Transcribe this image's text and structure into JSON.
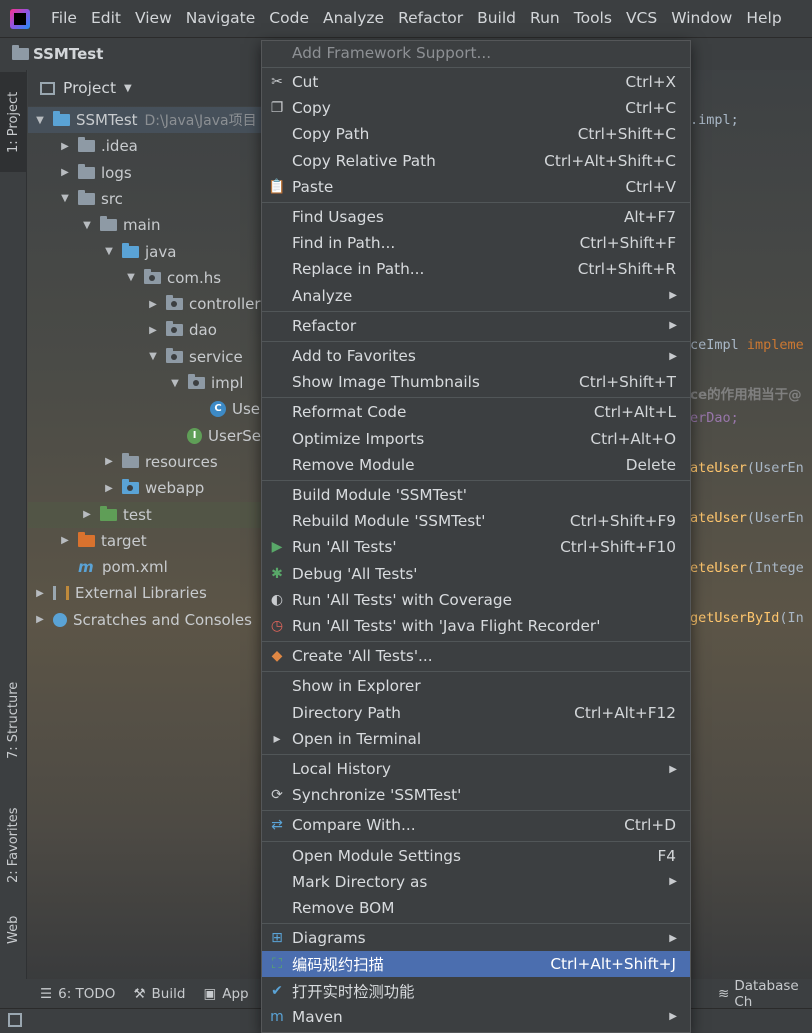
{
  "menubar": {
    "items": [
      "File",
      "Edit",
      "View",
      "Navigate",
      "Code",
      "Analyze",
      "Refactor",
      "Build",
      "Run",
      "Tools",
      "VCS",
      "Window",
      "Help"
    ]
  },
  "breadcrumb": {
    "project_name": "SSMTest"
  },
  "left_strip": {
    "project_tab": "1: Project",
    "structure_tab": "7: Structure",
    "favorites_tab": "2: Favorites",
    "web_tab": "Web"
  },
  "project_panel": {
    "header": "Project",
    "tree": [
      {
        "label": "SSMTest",
        "path": "D:\\Java\\Java项目",
        "arrow": "down",
        "icon": "module-folder",
        "selected": true
      },
      {
        "label": ".idea",
        "arrow": "right",
        "icon": "folder"
      },
      {
        "label": "logs",
        "arrow": "right",
        "icon": "folder"
      },
      {
        "label": "src",
        "arrow": "down",
        "icon": "folder"
      },
      {
        "label": "main",
        "arrow": "down",
        "icon": "folder"
      },
      {
        "label": "java",
        "arrow": "down",
        "icon": "source-folder"
      },
      {
        "label": "com.hs",
        "arrow": "down",
        "icon": "package"
      },
      {
        "label": "controller",
        "arrow": "right",
        "icon": "package"
      },
      {
        "label": "dao",
        "arrow": "right",
        "icon": "package"
      },
      {
        "label": "service",
        "arrow": "down",
        "icon": "package"
      },
      {
        "label": "impl",
        "arrow": "down",
        "icon": "package"
      },
      {
        "label": "Use",
        "arrow": "",
        "icon": "class"
      },
      {
        "label": "UserSe",
        "arrow": "",
        "icon": "interface"
      },
      {
        "label": "resources",
        "arrow": "right",
        "icon": "resources-folder"
      },
      {
        "label": "webapp",
        "arrow": "right",
        "icon": "web-folder"
      },
      {
        "label": "test",
        "arrow": "right",
        "icon": "test-folder",
        "highlight": true
      },
      {
        "label": "target",
        "arrow": "right",
        "icon": "excluded-folder"
      },
      {
        "label": "pom.xml",
        "arrow": "",
        "icon": "maven"
      },
      {
        "label": "External Libraries",
        "arrow": "right",
        "icon": "libraries"
      },
      {
        "label": "Scratches and Consoles",
        "arrow": "right",
        "icon": "scratches"
      }
    ]
  },
  "editor_fragments": [
    {
      "text": ".impl;",
      "kind": "plain"
    },
    {
      "text": "ceImpl ",
      "kind": "plain",
      "kw": "impleme"
    },
    {
      "text": "ce的作用相当于@",
      "kind": "comment"
    },
    {
      "text": "erDao;",
      "kind": "field"
    },
    {
      "text": "ateUser",
      "kind": "fn",
      "rest": "(UserEn"
    },
    {
      "text": "ateUser",
      "kind": "fn",
      "rest": "(UserEn"
    },
    {
      "text": "eteUser",
      "kind": "fn",
      "rest": "(Intege"
    },
    {
      "text": "getUserById",
      "kind": "fn",
      "rest": "(In"
    }
  ],
  "context_menu": {
    "partial_top": "Add Framework Support...",
    "groups": [
      [
        {
          "label": "Cut",
          "shortcut": "Ctrl+X",
          "icon": "cut"
        },
        {
          "label": "Copy",
          "shortcut": "Ctrl+C",
          "icon": "copy"
        },
        {
          "label": "Copy Path",
          "shortcut": "Ctrl+Shift+C"
        },
        {
          "label": "Copy Relative Path",
          "shortcut": "Ctrl+Alt+Shift+C"
        },
        {
          "label": "Paste",
          "shortcut": "Ctrl+V",
          "icon": "paste"
        }
      ],
      [
        {
          "label": "Find Usages",
          "shortcut": "Alt+F7"
        },
        {
          "label": "Find in Path...",
          "shortcut": "Ctrl+Shift+F"
        },
        {
          "label": "Replace in Path...",
          "shortcut": "Ctrl+Shift+R"
        },
        {
          "label": "Analyze",
          "submenu": true
        }
      ],
      [
        {
          "label": "Refactor",
          "submenu": true
        }
      ],
      [
        {
          "label": "Add to Favorites",
          "submenu": true
        },
        {
          "label": "Show Image Thumbnails",
          "shortcut": "Ctrl+Shift+T"
        }
      ],
      [
        {
          "label": "Reformat Code",
          "shortcut": "Ctrl+Alt+L"
        },
        {
          "label": "Optimize Imports",
          "shortcut": "Ctrl+Alt+O"
        },
        {
          "label": "Remove Module",
          "shortcut": "Delete"
        }
      ],
      [
        {
          "label": "Build Module 'SSMTest'"
        },
        {
          "label": "Rebuild Module 'SSMTest'",
          "shortcut": "Ctrl+Shift+F9"
        },
        {
          "label": "Run 'All Tests'",
          "shortcut": "Ctrl+Shift+F10",
          "icon": "run"
        },
        {
          "label": "Debug 'All Tests'",
          "icon": "debug"
        },
        {
          "label": "Run 'All Tests' with Coverage",
          "icon": "coverage"
        },
        {
          "label": "Run 'All Tests' with 'Java Flight Recorder'",
          "icon": "profiler"
        }
      ],
      [
        {
          "label": "Create 'All Tests'...",
          "icon": "create-config"
        }
      ],
      [
        {
          "label": "Show in Explorer"
        },
        {
          "label": "Directory Path",
          "shortcut": "Ctrl+Alt+F12"
        },
        {
          "label": "Open in Terminal",
          "icon": "terminal"
        }
      ],
      [
        {
          "label": "Local History",
          "submenu": true
        },
        {
          "label": "Synchronize 'SSMTest'",
          "icon": "sync"
        }
      ],
      [
        {
          "label": "Compare With...",
          "shortcut": "Ctrl+D",
          "icon": "compare"
        }
      ],
      [
        {
          "label": "Open Module Settings",
          "shortcut": "F4"
        },
        {
          "label": "Mark Directory as",
          "submenu": true
        },
        {
          "label": "Remove BOM"
        }
      ],
      [
        {
          "label": "Diagrams",
          "submenu": true,
          "icon": "diagram"
        },
        {
          "label": "编码规约扫描",
          "shortcut": "Ctrl+Alt+Shift+J",
          "icon": "alibaba-scan",
          "active": true
        },
        {
          "label": "打开实时检测功能",
          "icon": "realtime-check"
        },
        {
          "label": "Maven",
          "submenu": true,
          "icon": "maven"
        }
      ]
    ]
  },
  "bottom_bar": {
    "todo": "6: TODO",
    "build": "Build",
    "app": "App",
    "database": "Database Ch"
  },
  "colors": {
    "menu_bg": "#3c3f41",
    "selection": "#4b6eaf",
    "separator": "#515658"
  }
}
